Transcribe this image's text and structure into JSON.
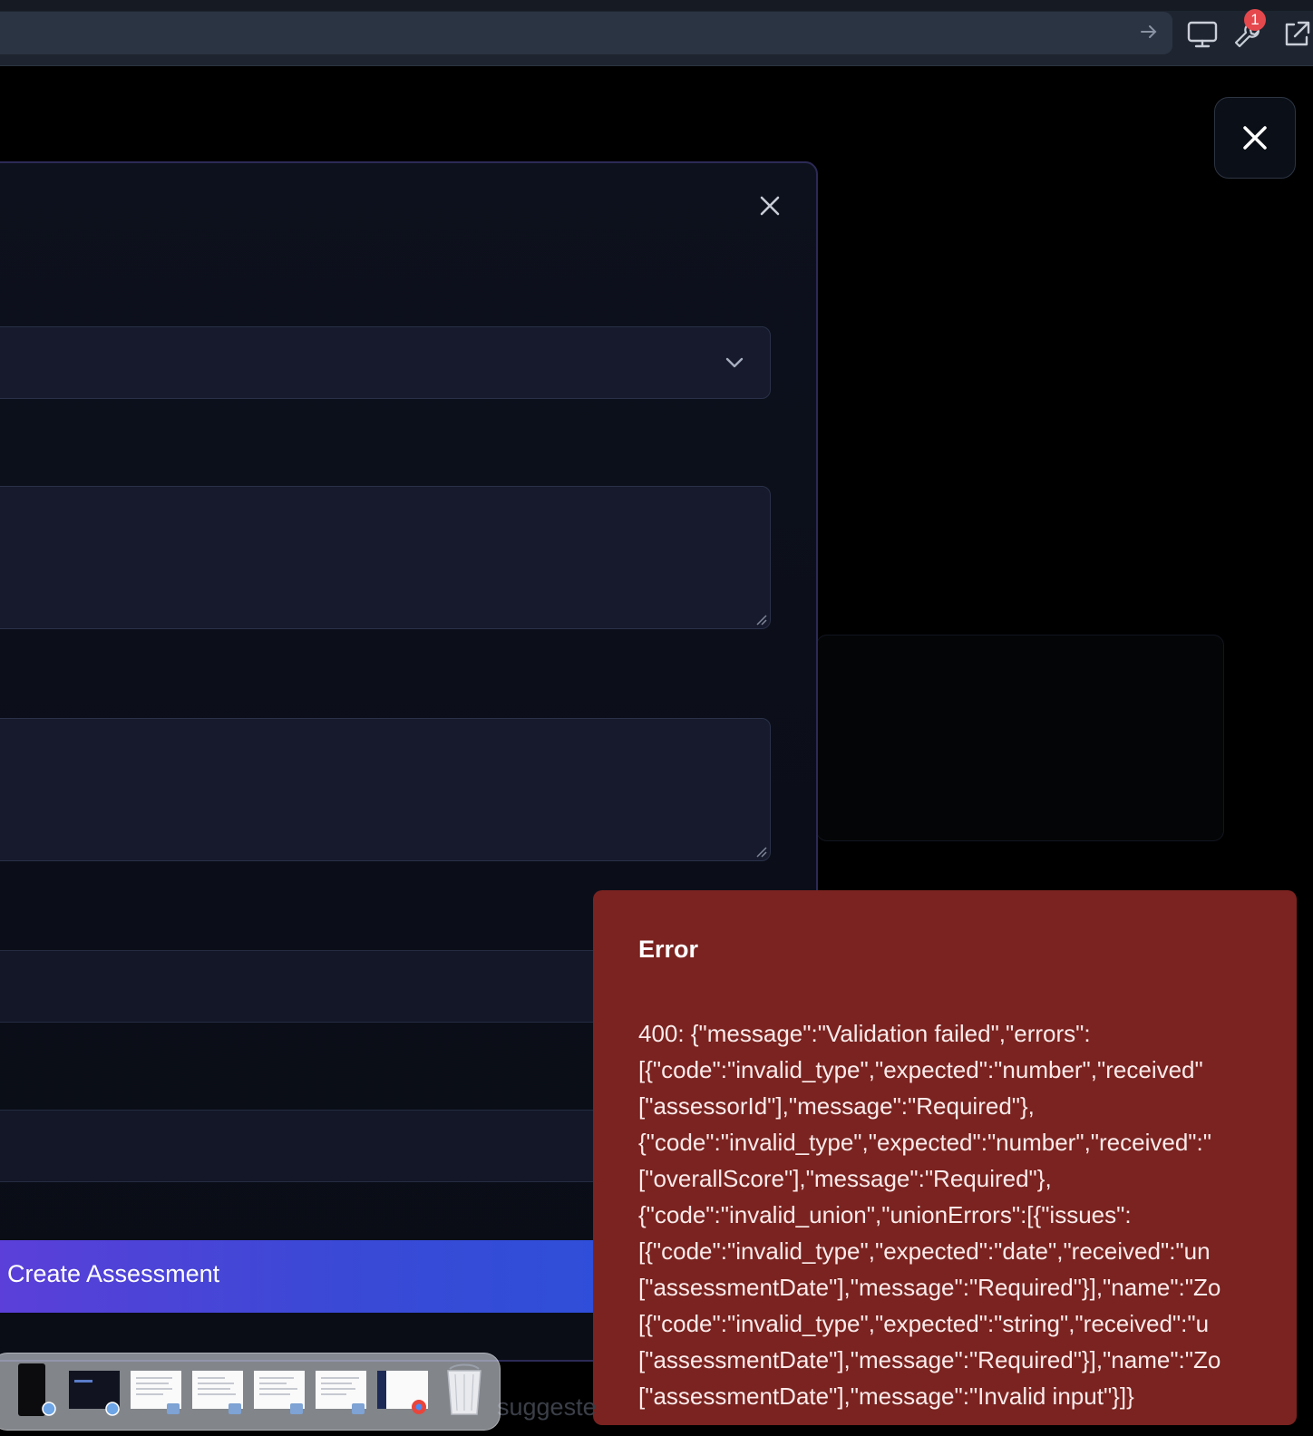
{
  "toolbar": {
    "notification_count": "1"
  },
  "modal": {
    "submit_label": "Create Assessment"
  },
  "error": {
    "title": "Error",
    "message_lines": [
      "400: {\"message\":\"Validation failed\",\"errors\":",
      "[{\"code\":\"invalid_type\",\"expected\":\"number\",\"received\"",
      "[\"assessorId\"],\"message\":\"Required\"},",
      "{\"code\":\"invalid_type\",\"expected\":\"number\",\"received\":\"",
      "[\"overallScore\"],\"message\":\"Required\"},",
      "{\"code\":\"invalid_union\",\"unionErrors\":[{\"issues\":",
      "[{\"code\":\"invalid_type\",\"expected\":\"date\",\"received\":\"un",
      "[\"assessmentDate\"],\"message\":\"Required\"}],\"name\":\"Zo",
      "[{\"code\":\"invalid_type\",\"expected\":\"string\",\"received\":\"u",
      "[\"assessmentDate\"],\"message\":\"Required\"}],\"name\":\"Zo",
      "[\"assessmentDate\"],\"message\":\"Invalid input\"}]}"
    ]
  },
  "background": {
    "partial_text": "suggeste"
  },
  "dock": {
    "items": [
      "phone-mirror-app",
      "dark-app-window",
      "document-1",
      "document-2",
      "document-3",
      "document-4",
      "chrome-window",
      "trash"
    ]
  }
}
